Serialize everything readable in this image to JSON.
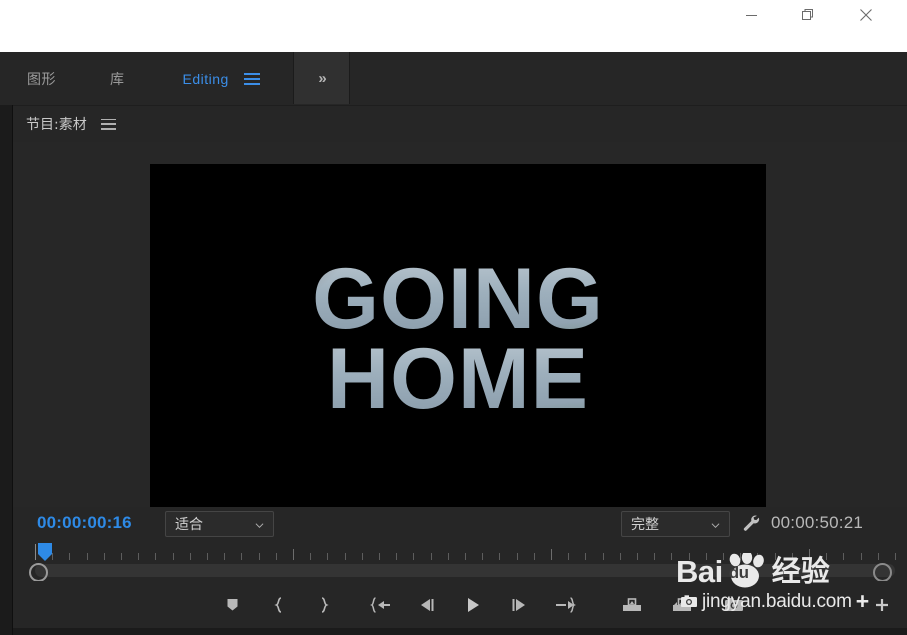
{
  "window": {
    "minimize_label": "Minimize",
    "maximize_label": "Restore",
    "close_label": "Close"
  },
  "workspace_bar": {
    "tabs": [
      {
        "label": "图形",
        "active": false
      },
      {
        "label": "库",
        "active": false
      },
      {
        "label": "Editing",
        "active": true
      }
    ],
    "menu_icon": "hamburger-icon",
    "overflow_label": "»",
    "accent_color": "#3b8ee8"
  },
  "program_panel": {
    "tab_label": "节目:素材",
    "tab_menu_icon": "hamburger-icon"
  },
  "monitor": {
    "video_title_line1": "GOING",
    "video_title_line2": "HOME",
    "background_color": "#000000"
  },
  "transport_row": {
    "current_timecode": "00:00:00:16",
    "current_timecode_color": "#2e8ae6",
    "zoom_level": "适合",
    "quality_level": "完整",
    "settings_icon": "wrench-icon",
    "duration_timecode": "00:00:50:21",
    "duration_timecode_color": "#b8b8b8"
  },
  "buttons": [
    {
      "name": "add-marker-button",
      "icon": "marker-icon"
    },
    {
      "name": "mark-in-button",
      "icon": "mark-in-icon"
    },
    {
      "name": "mark-out-button",
      "icon": "mark-out-icon"
    },
    {
      "name": "go-to-in-button",
      "icon": "go-to-in-icon"
    },
    {
      "name": "step-back-button",
      "icon": "step-back-icon"
    },
    {
      "name": "play-stop-button",
      "icon": "play-icon"
    },
    {
      "name": "step-forward-button",
      "icon": "step-forward-icon"
    },
    {
      "name": "go-to-out-button",
      "icon": "go-to-out-icon"
    },
    {
      "name": "lift-button",
      "icon": "lift-icon"
    },
    {
      "name": "extract-button",
      "icon": "extract-icon"
    },
    {
      "name": "export-frame-button",
      "icon": "camera-icon"
    },
    {
      "name": "button-editor-button",
      "icon": "plus-icon"
    }
  ],
  "watermark": {
    "brand": "Bai",
    "du": "du",
    "suffix": "经验",
    "url": "jingyan.baidu.com",
    "plus": "+",
    "camera_icon": "camera-icon"
  }
}
